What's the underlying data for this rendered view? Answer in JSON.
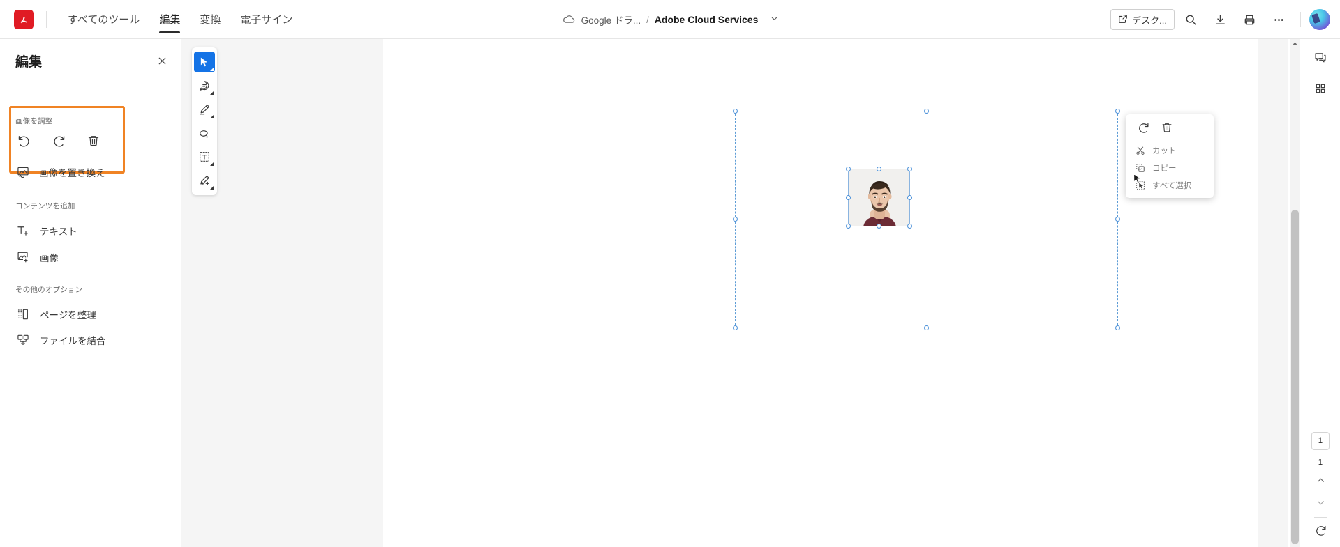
{
  "app": {
    "logo_icon": "acrobat-logo-icon",
    "tabs": [
      {
        "label": "すべてのツール",
        "name": "tab-all-tools",
        "active": false
      },
      {
        "label": "編集",
        "name": "tab-edit",
        "active": true
      },
      {
        "label": "変換",
        "name": "tab-convert",
        "active": false
      },
      {
        "label": "電子サイン",
        "name": "tab-esign",
        "active": false
      }
    ]
  },
  "breadcrumb": {
    "cloud_icon": "cloud-icon",
    "location": "Google ドラ...",
    "separator": "/",
    "file_name": "Adobe Cloud Services",
    "caret_icon": "chevron-down-icon"
  },
  "topbar_right": {
    "desktop_button": "デスク...",
    "desktop_icon": "external-link-icon",
    "search_icon": "search-icon",
    "download_icon": "download-icon",
    "print_icon": "print-icon",
    "more_icon": "ellipsis-icon",
    "avatar": "user-avatar"
  },
  "left_panel": {
    "title": "編集",
    "close_icon": "close-icon",
    "sections": [
      {
        "label": "画像を調整",
        "name": "section-adjust-image",
        "highlighted": true,
        "buttons": [
          {
            "name": "rotate-counterclockwise-button",
            "icon": "rotate-left-icon"
          },
          {
            "name": "rotate-clockwise-button",
            "icon": "rotate-right-icon"
          },
          {
            "name": "delete-image-button",
            "icon": "trash-icon"
          }
        ],
        "replace_label": "画像を置き換え",
        "replace_icon": "replace-image-icon"
      },
      {
        "label": "コンテンツを追加",
        "name": "section-add-content",
        "items": [
          {
            "label": "テキスト",
            "name": "add-text-item",
            "icon": "text-add-icon"
          },
          {
            "label": "画像",
            "name": "add-image-item",
            "icon": "image-add-icon"
          }
        ]
      },
      {
        "label": "その他のオプション",
        "name": "section-other-options",
        "items": [
          {
            "label": "ページを整理",
            "name": "organize-pages-item",
            "icon": "organize-pages-icon"
          },
          {
            "label": "ファイルを結合",
            "name": "combine-files-item",
            "icon": "combine-files-icon"
          }
        ]
      }
    ]
  },
  "tool_rail": [
    {
      "name": "tool-select",
      "icon": "cursor-arrow-icon",
      "active": true
    },
    {
      "name": "tool-comment",
      "icon": "comment-bubble-icon",
      "active": false
    },
    {
      "name": "tool-highlight",
      "icon": "highlighter-pen-icon",
      "active": false
    },
    {
      "name": "tool-lasso",
      "icon": "lasso-icon",
      "active": false
    },
    {
      "name": "tool-text-field",
      "icon": "text-box-icon",
      "active": false
    },
    {
      "name": "tool-signature",
      "icon": "fill-and-sign-icon",
      "active": false
    }
  ],
  "context_menu": {
    "icon_buttons": [
      {
        "name": "rotate-button",
        "icon": "rotate-right-icon"
      },
      {
        "name": "delete-button",
        "icon": "trash-icon"
      }
    ],
    "items": [
      {
        "label": "カット",
        "name": "cut-menu-item",
        "icon": "scissors-icon"
      },
      {
        "label": "コピー",
        "name": "copy-menu-item",
        "icon": "copy-icon"
      },
      {
        "label": "すべて選択",
        "name": "select-all-menu-item",
        "icon": "select-all-icon"
      }
    ]
  },
  "right_rail": {
    "comment_icon": "comment-panel-icon",
    "apps_icon": "all-apps-grid-icon",
    "current_page": "1",
    "total_pages": "1",
    "prev_icon": "chevron-up-icon",
    "next_icon": "chevron-down-icon",
    "rotate_icon": "rotate-view-icon"
  },
  "document": {
    "selected_object": "image",
    "photo_alt": "portrait-photo"
  },
  "colors": {
    "accent_blue": "#1473e6",
    "highlight_orange": "#f08324",
    "selection_blue": "#5b9bd5",
    "brand_red": "#e01b24"
  }
}
